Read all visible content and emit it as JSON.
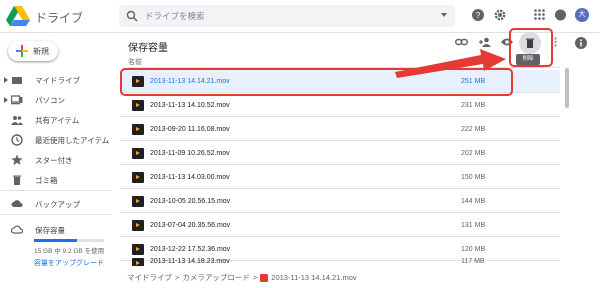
{
  "app": {
    "name": "ドライブ"
  },
  "search": {
    "placeholder": "ドライブを検索"
  },
  "user": {
    "avatar_initial": "大"
  },
  "sidebar": {
    "new_label": "新規",
    "items": [
      {
        "label": "マイドライブ",
        "icon": "my-drive-icon",
        "expandable": true
      },
      {
        "label": "パソコン",
        "icon": "computer-icon",
        "expandable": true
      },
      {
        "label": "共有アイテム",
        "icon": "shared-icon",
        "expandable": false
      },
      {
        "label": "最近使用したアイテム",
        "icon": "recent-icon",
        "expandable": false
      },
      {
        "label": "スター付き",
        "icon": "star-icon",
        "expandable": false
      },
      {
        "label": "ゴミ箱",
        "icon": "trash-icon",
        "expandable": false
      }
    ],
    "backup_label": "バックアップ",
    "storage": {
      "label": "保存容量",
      "usage_text": "15 GB 中 9.2 GB を使用",
      "used_fraction": 0.61,
      "upgrade_label": "容量をアップグレード"
    }
  },
  "main": {
    "title": "保存容量",
    "column_name": "名前",
    "delete_tooltip": "削除",
    "files": [
      {
        "name": "2013-11-13 14.14.21.mov",
        "size": "251 MB",
        "selected": true
      },
      {
        "name": "2013-11-13 14.10.52.mov",
        "size": "231 MB",
        "selected": false
      },
      {
        "name": "2013-09-20 11.16.08.mov",
        "size": "222 MB",
        "selected": false
      },
      {
        "name": "2013-11-09 10.26.52.mov",
        "size": "202 MB",
        "selected": false
      },
      {
        "name": "2013-11-13 14.03.00.mov",
        "size": "150 MB",
        "selected": false
      },
      {
        "name": "2013-10-05 20.56.15.mov",
        "size": "144 MB",
        "selected": false
      },
      {
        "name": "2013-07-04 20.35.56.mov",
        "size": "131 MB",
        "selected": false
      },
      {
        "name": "2013-12-22 17.52.36.mov",
        "size": "120 MB",
        "selected": false
      },
      {
        "name": "2013-11-13 14.18.23.mov",
        "size": "117 MB",
        "selected": false
      }
    ]
  },
  "breadcrumb": {
    "items": [
      "マイドライブ",
      "カメラアップロード"
    ],
    "separator": ">",
    "current": "2013-11-13 14.14.21.mov"
  },
  "colors": {
    "accent": "#1a73e8",
    "highlight": "#e53935",
    "selected_row": "#e8f0fe"
  }
}
